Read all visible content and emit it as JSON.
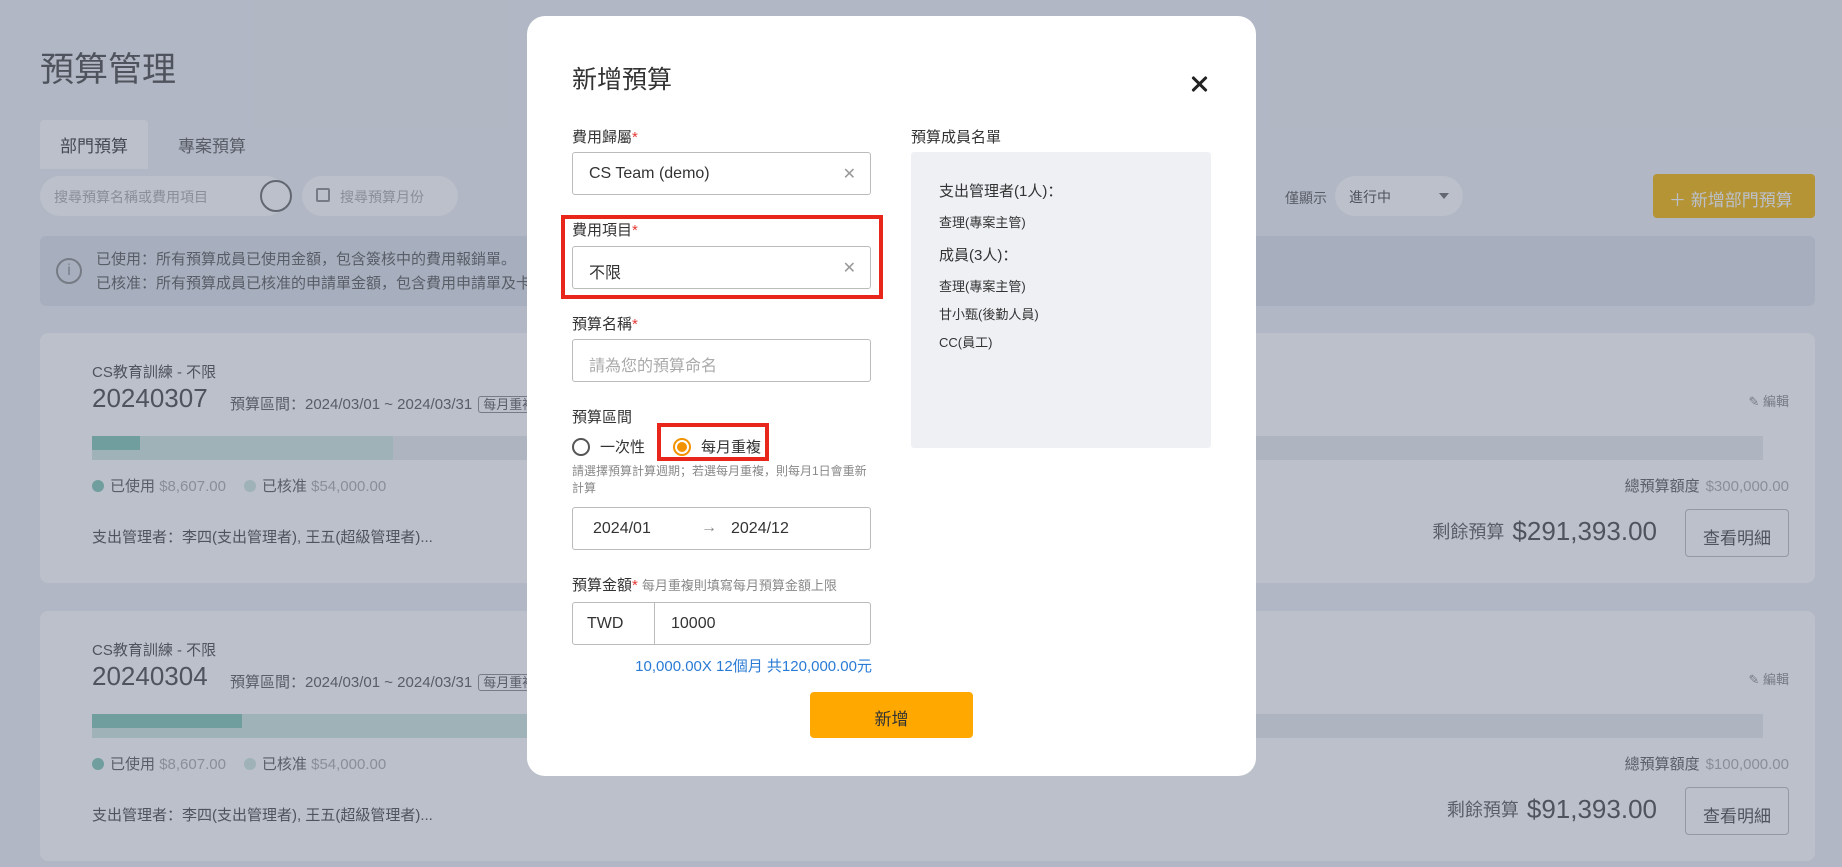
{
  "page": {
    "title": "預算管理",
    "tabs": [
      {
        "label": "部門預算"
      },
      {
        "label": "專案預算"
      }
    ],
    "search_placeholder": "搜尋預算名稱或費用項目",
    "month_placeholder": "搜尋預算月份",
    "filter_label": "僅顯示",
    "filter_value": "進行中",
    "add_button": "新增部門預算",
    "info_lines": [
      "已使用：所有預算成員已使用金額，包含簽核中的費用報銷單。",
      "已核准：所有預算成員已核准的申請單金額，包含費用申請單及卡片"
    ],
    "cards": [
      {
        "subtitle": "CS教育訓練 - 不限",
        "number": "20240307",
        "period": "預算區間：2024/03/01 ~ 2024/03/31",
        "tag": "每月重複",
        "used_label": "已使用",
        "used_value": "$8,607.00",
        "approved_label": "已核准",
        "approved_value": "$54,000.00",
        "managers": "支出管理者：李四(支出管理者), 王五(超級管理者)...",
        "edit_label": "編輯",
        "total_label": "總預算額度",
        "total_value": "$300,000.00",
        "remain_label": "剩餘預算",
        "remain_value": "$291,393.00",
        "detail_button": "查看明細",
        "used_fraction": 0.029,
        "approved_fraction": 0.18
      },
      {
        "subtitle": "CS教育訓練 - 不限",
        "number": "20240304",
        "period": "預算區間：2024/03/01 ~ 2024/03/31",
        "tag": "每月重複",
        "used_label": "已使用",
        "used_value": "$8,607.00",
        "approved_label": "已核准",
        "approved_value": "$54,000.00",
        "managers": "支出管理者：李四(支出管理者), 王五(超級管理者)...",
        "edit_label": "編輯",
        "total_label": "總預算額度",
        "total_value": "$100,000.00",
        "remain_label": "剩餘預算",
        "remain_value": "$91,393.00",
        "detail_button": "查看明細",
        "used_fraction": 0.09,
        "approved_fraction": 0.54
      }
    ]
  },
  "modal": {
    "title": "新增預算",
    "expense_owner": {
      "label": "費用歸屬",
      "value": "CS Team (demo)"
    },
    "expense_item": {
      "label": "費用項目",
      "value": "不限"
    },
    "budget_name": {
      "label": "預算名稱",
      "placeholder": "請為您的預算命名"
    },
    "period": {
      "label": "預算區間",
      "options": [
        {
          "label": "一次性",
          "checked": false
        },
        {
          "label": "每月重複",
          "checked": true
        }
      ],
      "hint": "請選擇預算計算週期；若選每月重複，則每月1日會重新計算",
      "from": "2024/01",
      "to": "2024/12"
    },
    "amount": {
      "label": "預算金額",
      "note": "每月重複則填寫每月預算金額上限",
      "currency": "TWD",
      "value": "10000",
      "calc": "10,000.00X 12個月 共120,000.00元"
    },
    "submit_button": "新增",
    "members": {
      "label": "預算成員名單",
      "manager_heading": "支出管理者(1人)：",
      "managers": [
        "查理(專案主管)"
      ],
      "member_heading": "成員(3人)：",
      "members": [
        "查理(專案主管)",
        "甘小甄(後勤人員)",
        "CC(員工)"
      ]
    }
  },
  "colors": {
    "accent": "#ffa800",
    "highlight": "#e8261c",
    "link": "#2a7bd5",
    "used": "#7ec4b4",
    "approved": "#cde7e1"
  }
}
